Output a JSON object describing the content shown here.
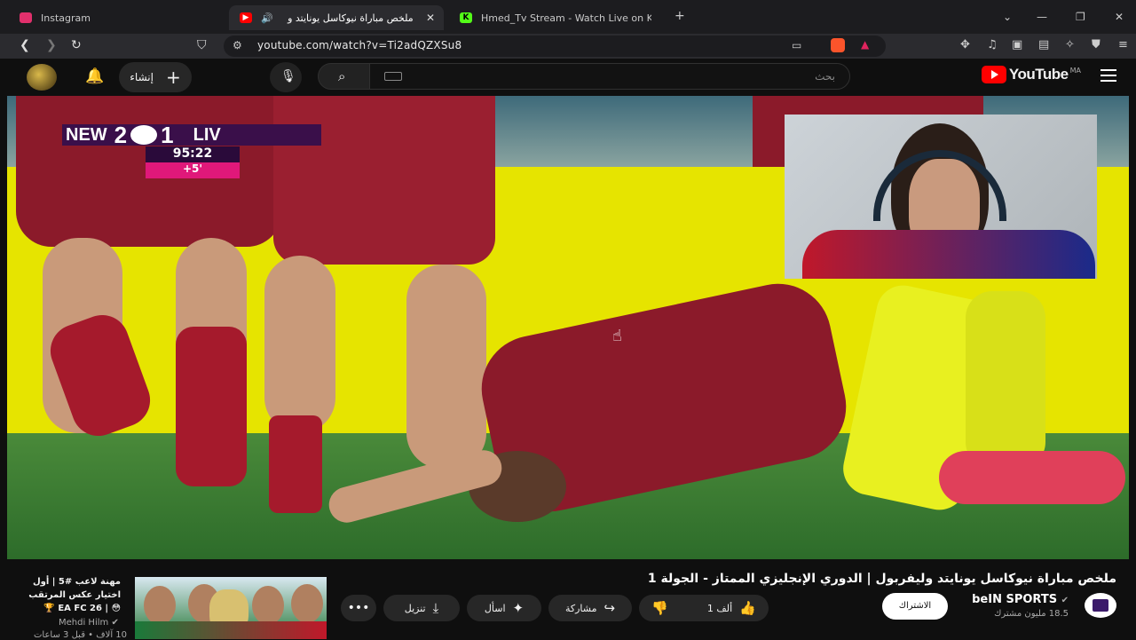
{
  "browser": {
    "tabs": [
      {
        "title": "Instagram"
      },
      {
        "title": "ملخص مباراة نيوكاسل يونايتد و"
      },
      {
        "title": "Hmed_Tv Stream - Watch Live on Kick"
      }
    ],
    "url": "youtube.com/watch?v=Ti2adQZXSu8"
  },
  "youtube": {
    "logo_text": "YouTube",
    "country_code": "MA",
    "search_placeholder": "بحث",
    "create_label": "إنشاء"
  },
  "video": {
    "scorebug": {
      "home": "NEW",
      "home_score": "2",
      "away_score": "1",
      "away": "LIV"
    },
    "clock": "95:22",
    "added_time": "+5'"
  },
  "details": {
    "title": "ملخص مباراة نيوكاسل يونايتد وليفربول | الدوري الإنجليزي الممتاز - الجولة 1",
    "channel_name": "beIN SPORTS",
    "subscribers": "18.5 مليون مشترك",
    "subscribe_label": "الاشتراك",
    "like_count": "1 ألف",
    "share_label": "مشاركة",
    "ask_label": "اسأل",
    "download_label": "تنزيل"
  },
  "recommendation": {
    "title": "مهنة لاعب #5 | أول اختيار عكس المرتقب 😳 | EA FC 26 🏆",
    "channel": "Mehdi Hilm",
    "views": "10 آلاف",
    "age": "قبل 3 ساعات"
  }
}
